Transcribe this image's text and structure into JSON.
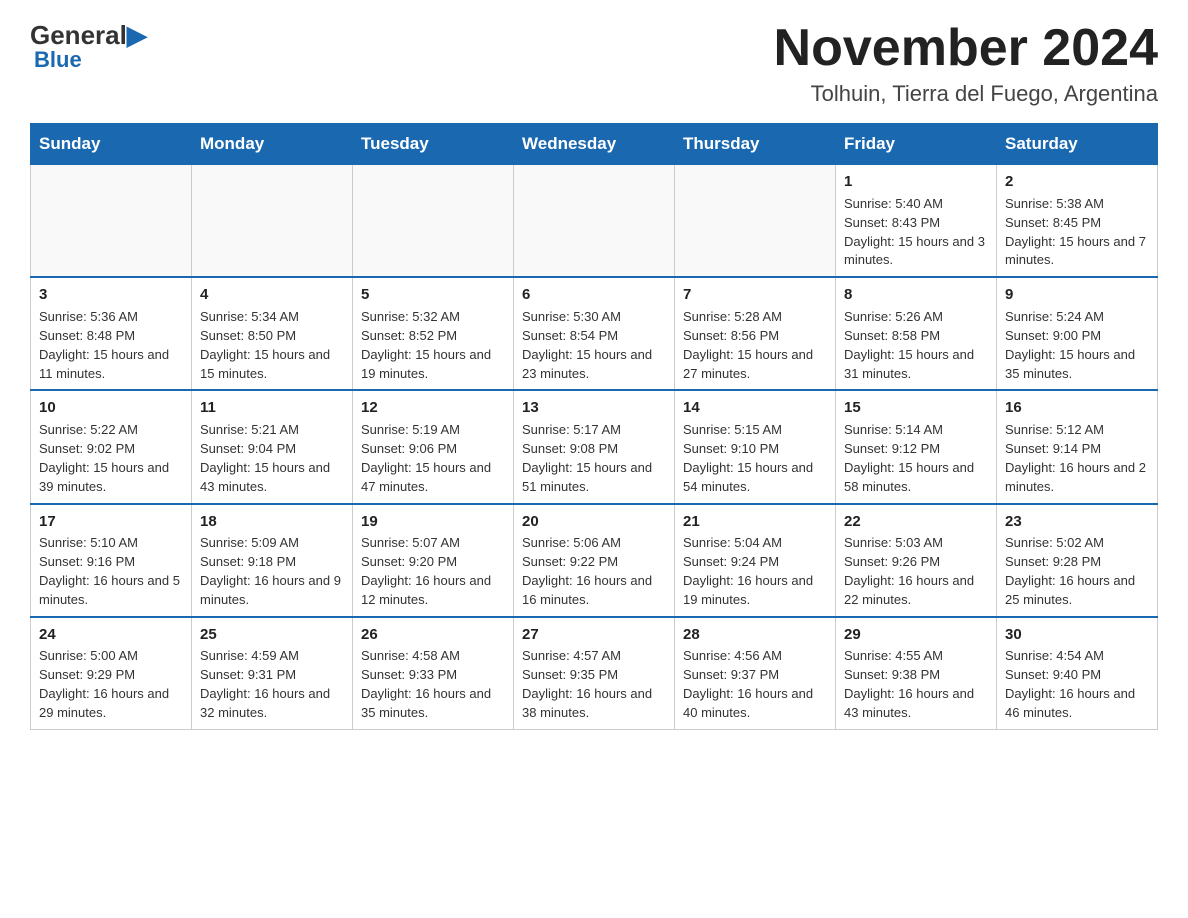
{
  "logo": {
    "general": "General",
    "blue": "Blue",
    "bottom": "Blue"
  },
  "header": {
    "month_title": "November 2024",
    "location": "Tolhuin, Tierra del Fuego, Argentina"
  },
  "weekdays": [
    "Sunday",
    "Monday",
    "Tuesday",
    "Wednesday",
    "Thursday",
    "Friday",
    "Saturday"
  ],
  "weeks": [
    [
      {
        "day": "",
        "info": ""
      },
      {
        "day": "",
        "info": ""
      },
      {
        "day": "",
        "info": ""
      },
      {
        "day": "",
        "info": ""
      },
      {
        "day": "",
        "info": ""
      },
      {
        "day": "1",
        "info": "Sunrise: 5:40 AM\nSunset: 8:43 PM\nDaylight: 15 hours and 3 minutes."
      },
      {
        "day": "2",
        "info": "Sunrise: 5:38 AM\nSunset: 8:45 PM\nDaylight: 15 hours and 7 minutes."
      }
    ],
    [
      {
        "day": "3",
        "info": "Sunrise: 5:36 AM\nSunset: 8:48 PM\nDaylight: 15 hours and 11 minutes."
      },
      {
        "day": "4",
        "info": "Sunrise: 5:34 AM\nSunset: 8:50 PM\nDaylight: 15 hours and 15 minutes."
      },
      {
        "day": "5",
        "info": "Sunrise: 5:32 AM\nSunset: 8:52 PM\nDaylight: 15 hours and 19 minutes."
      },
      {
        "day": "6",
        "info": "Sunrise: 5:30 AM\nSunset: 8:54 PM\nDaylight: 15 hours and 23 minutes."
      },
      {
        "day": "7",
        "info": "Sunrise: 5:28 AM\nSunset: 8:56 PM\nDaylight: 15 hours and 27 minutes."
      },
      {
        "day": "8",
        "info": "Sunrise: 5:26 AM\nSunset: 8:58 PM\nDaylight: 15 hours and 31 minutes."
      },
      {
        "day": "9",
        "info": "Sunrise: 5:24 AM\nSunset: 9:00 PM\nDaylight: 15 hours and 35 minutes."
      }
    ],
    [
      {
        "day": "10",
        "info": "Sunrise: 5:22 AM\nSunset: 9:02 PM\nDaylight: 15 hours and 39 minutes."
      },
      {
        "day": "11",
        "info": "Sunrise: 5:21 AM\nSunset: 9:04 PM\nDaylight: 15 hours and 43 minutes."
      },
      {
        "day": "12",
        "info": "Sunrise: 5:19 AM\nSunset: 9:06 PM\nDaylight: 15 hours and 47 minutes."
      },
      {
        "day": "13",
        "info": "Sunrise: 5:17 AM\nSunset: 9:08 PM\nDaylight: 15 hours and 51 minutes."
      },
      {
        "day": "14",
        "info": "Sunrise: 5:15 AM\nSunset: 9:10 PM\nDaylight: 15 hours and 54 minutes."
      },
      {
        "day": "15",
        "info": "Sunrise: 5:14 AM\nSunset: 9:12 PM\nDaylight: 15 hours and 58 minutes."
      },
      {
        "day": "16",
        "info": "Sunrise: 5:12 AM\nSunset: 9:14 PM\nDaylight: 16 hours and 2 minutes."
      }
    ],
    [
      {
        "day": "17",
        "info": "Sunrise: 5:10 AM\nSunset: 9:16 PM\nDaylight: 16 hours and 5 minutes."
      },
      {
        "day": "18",
        "info": "Sunrise: 5:09 AM\nSunset: 9:18 PM\nDaylight: 16 hours and 9 minutes."
      },
      {
        "day": "19",
        "info": "Sunrise: 5:07 AM\nSunset: 9:20 PM\nDaylight: 16 hours and 12 minutes."
      },
      {
        "day": "20",
        "info": "Sunrise: 5:06 AM\nSunset: 9:22 PM\nDaylight: 16 hours and 16 minutes."
      },
      {
        "day": "21",
        "info": "Sunrise: 5:04 AM\nSunset: 9:24 PM\nDaylight: 16 hours and 19 minutes."
      },
      {
        "day": "22",
        "info": "Sunrise: 5:03 AM\nSunset: 9:26 PM\nDaylight: 16 hours and 22 minutes."
      },
      {
        "day": "23",
        "info": "Sunrise: 5:02 AM\nSunset: 9:28 PM\nDaylight: 16 hours and 25 minutes."
      }
    ],
    [
      {
        "day": "24",
        "info": "Sunrise: 5:00 AM\nSunset: 9:29 PM\nDaylight: 16 hours and 29 minutes."
      },
      {
        "day": "25",
        "info": "Sunrise: 4:59 AM\nSunset: 9:31 PM\nDaylight: 16 hours and 32 minutes."
      },
      {
        "day": "26",
        "info": "Sunrise: 4:58 AM\nSunset: 9:33 PM\nDaylight: 16 hours and 35 minutes."
      },
      {
        "day": "27",
        "info": "Sunrise: 4:57 AM\nSunset: 9:35 PM\nDaylight: 16 hours and 38 minutes."
      },
      {
        "day": "28",
        "info": "Sunrise: 4:56 AM\nSunset: 9:37 PM\nDaylight: 16 hours and 40 minutes."
      },
      {
        "day": "29",
        "info": "Sunrise: 4:55 AM\nSunset: 9:38 PM\nDaylight: 16 hours and 43 minutes."
      },
      {
        "day": "30",
        "info": "Sunrise: 4:54 AM\nSunset: 9:40 PM\nDaylight: 16 hours and 46 minutes."
      }
    ]
  ]
}
